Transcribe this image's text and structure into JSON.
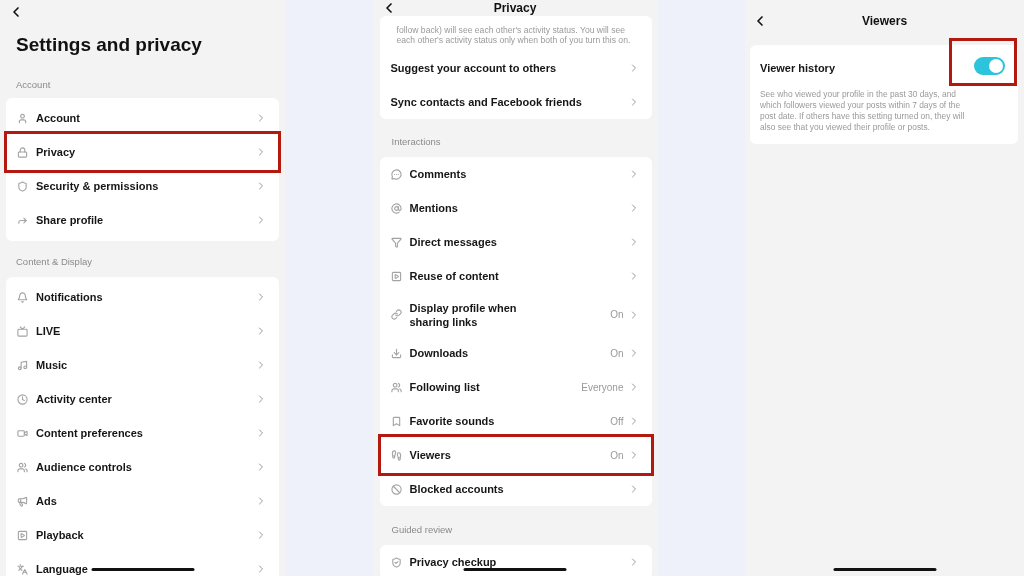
{
  "settings_screen": {
    "title": "Settings and privacy",
    "sections": [
      {
        "label": "Account",
        "items": [
          {
            "label": "Account",
            "highlighted": false
          },
          {
            "label": "Privacy",
            "highlighted": true
          },
          {
            "label": "Security & permissions",
            "highlighted": false
          },
          {
            "label": "Share profile",
            "highlighted": false
          }
        ]
      },
      {
        "label": "Content & Display",
        "items": [
          {
            "label": "Notifications",
            "highlighted": false
          },
          {
            "label": "LIVE",
            "highlighted": false
          },
          {
            "label": "Music",
            "highlighted": false
          },
          {
            "label": "Activity center",
            "highlighted": false
          },
          {
            "label": "Content preferences",
            "highlighted": false
          },
          {
            "label": "Audience controls",
            "highlighted": false
          },
          {
            "label": "Ads",
            "highlighted": false
          },
          {
            "label": "Playback",
            "highlighted": false
          },
          {
            "label": "Language",
            "highlighted": false
          }
        ]
      }
    ]
  },
  "privacy_screen": {
    "title": "Privacy",
    "sections": [
      {
        "note_lines": [
          "follow back) will see each other's activity status. You will see",
          "each other's activity status only when both of you turn this on."
        ],
        "items": [
          {
            "label": "Suggest your account to others",
            "highlighted": false
          },
          {
            "label": "Sync contacts and Facebook friends",
            "highlighted": false
          }
        ]
      },
      {
        "label": "Interactions",
        "items": [
          {
            "label": "Comments",
            "highlighted": false
          },
          {
            "label": "Mentions",
            "highlighted": false
          },
          {
            "label": "Direct messages",
            "highlighted": false
          },
          {
            "label": "Reuse of content",
            "highlighted": false
          },
          {
            "label": "Display profile when sharing links",
            "value": "On",
            "highlighted": false
          },
          {
            "label": "Downloads",
            "value": "On",
            "highlighted": false
          },
          {
            "label": "Following list",
            "value": "Everyone",
            "highlighted": false
          },
          {
            "label": "Favorite sounds",
            "value": "Off",
            "highlighted": false
          },
          {
            "label": "Viewers",
            "value": "On",
            "highlighted": true
          },
          {
            "label": "Blocked accounts",
            "highlighted": false
          }
        ]
      },
      {
        "label": "Guided review",
        "items": [
          {
            "label": "Privacy checkup",
            "highlighted": false
          }
        ]
      }
    ]
  },
  "viewers_screen": {
    "title": "Viewers",
    "setting": {
      "label": "Viewer history",
      "description": "See who viewed your profile in the past 30 days, and which followers viewed your posts within 7 days of the post date. If others have this setting turned on, they will also see that you viewed their profile or posts.",
      "on": true,
      "highlighted": true
    }
  }
}
